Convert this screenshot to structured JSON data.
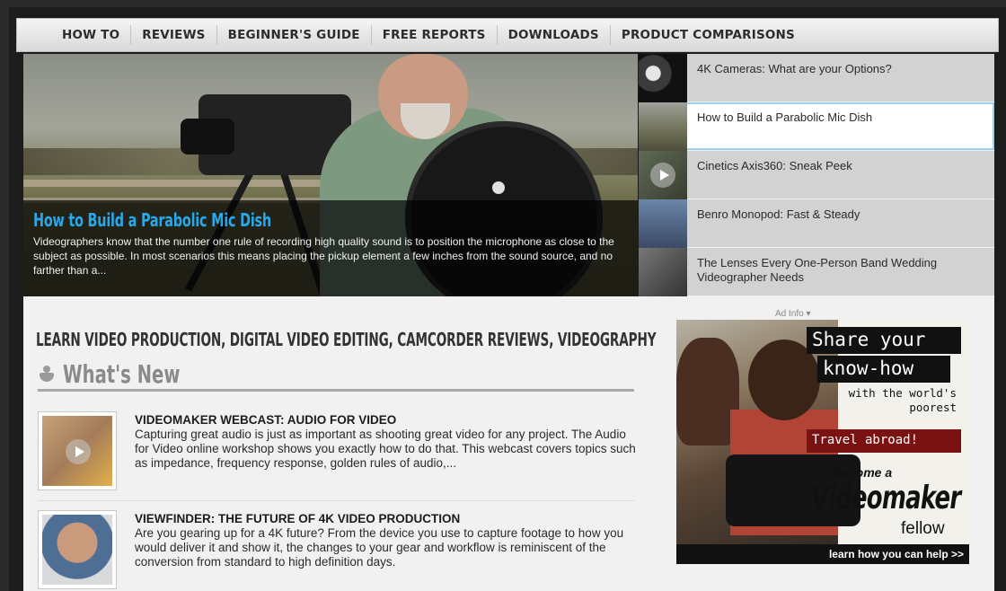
{
  "nav": {
    "items": [
      "HOW TO",
      "REVIEWS",
      "BEGINNER'S GUIDE",
      "FREE REPORTS",
      "DOWNLOADS",
      "PRODUCT COMPARISONS"
    ]
  },
  "hero": {
    "title": "How to Build a Parabolic Mic Dish",
    "text": "Videographers know that the number one rule of recording high quality sound is to position the microphone as close to the subject as possible. In most scenarios this means placing the pickup element a few inches from the sound source, and no farther than a..."
  },
  "side_list": [
    {
      "label": "4K Cameras: What are your Options?",
      "active": false
    },
    {
      "label": "How to Build a Parabolic Mic Dish",
      "active": true
    },
    {
      "label": "Cinetics Axis360: Sneak Peek",
      "active": false
    },
    {
      "label": "Benro Monopod: Fast & Steady",
      "active": false
    },
    {
      "label": "The Lenses Every One-Person Band Wedding Videographer Needs",
      "active": false
    }
  ],
  "main": {
    "headline": "LEARN VIDEO PRODUCTION, DIGITAL VIDEO EDITING, CAMCORDER REVIEWS, VIDEOGRAPHY",
    "section_title": "What's New",
    "articles": [
      {
        "title": "VIDEOMAKER WEBCAST: AUDIO FOR VIDEO",
        "text": "Capturing great audio is just as important as shooting great video for any project. The Audio for Video online workshop shows you exactly how to do that. This webcast covers topics such as impedance, frequency response, golden rules of audio,..."
      },
      {
        "title": "VIEWFINDER: THE FUTURE OF 4K VIDEO PRODUCTION",
        "text": "Are you gearing up for a 4K future? From the device you use to capture footage to how you would deliver it and show it, the changes to your gear and workflow is reminiscent of the conversion from standard to high definition days."
      }
    ]
  },
  "ad": {
    "info_label": "Ad Info",
    "line1": "Share your",
    "line2": "know-how",
    "line3": "with the world's poorest",
    "line4": "Travel abroad!",
    "line5": "Become a",
    "brand": "Videomaker",
    "line6": "fellow",
    "cta": "learn how you can help >>"
  },
  "colors": {
    "hero_title": "#28a8e8",
    "active_border": "#9ad0ea",
    "ad_red": "#7a1212"
  }
}
